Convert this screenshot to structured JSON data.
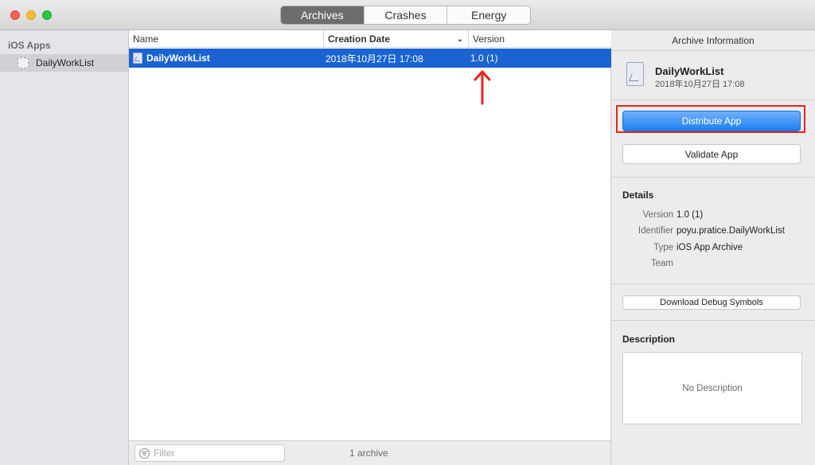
{
  "titlebar": {
    "tabs": [
      {
        "label": "Archives",
        "active": true
      },
      {
        "label": "Crashes",
        "active": false
      },
      {
        "label": "Energy",
        "active": false
      }
    ]
  },
  "sidebar": {
    "section_header": "iOS Apps",
    "items": [
      {
        "label": "DailyWorkList",
        "icon": "app-icon",
        "selected": true
      }
    ]
  },
  "archive_list": {
    "columns": {
      "name": "Name",
      "creation_date": "Creation Date",
      "version": "Version"
    },
    "rows": [
      {
        "name": "DailyWorkList",
        "creation_date": "2018年10月27日 17:08",
        "version": "1.0 (1)",
        "selected": true
      }
    ],
    "annotation_arrow_color": "#e8241c"
  },
  "bottombar": {
    "filter_placeholder": "Filter",
    "count_label": "1 archive"
  },
  "inspector": {
    "title": "Archive Information",
    "app_name": "DailyWorkList",
    "app_date": "2018年10月27日 17:08",
    "distribute_label": "Distribute App",
    "validate_label": "Validate App",
    "details_header": "Details",
    "details": {
      "version_key": "Version",
      "version_val": "1.0 (1)",
      "identifier_key": "Identifier",
      "identifier_val": "poyu.pratice.DailyWorkList",
      "type_key": "Type",
      "type_val": "iOS App Archive",
      "team_key": "Team",
      "team_val": ""
    },
    "debug_symbols_label": "Download Debug Symbols",
    "description_header": "Description",
    "description_placeholder": "No Description"
  },
  "colors": {
    "selection_blue": "#1a63d1",
    "primary_button": "#1e7ff4",
    "highlight_red": "#e8241c"
  }
}
